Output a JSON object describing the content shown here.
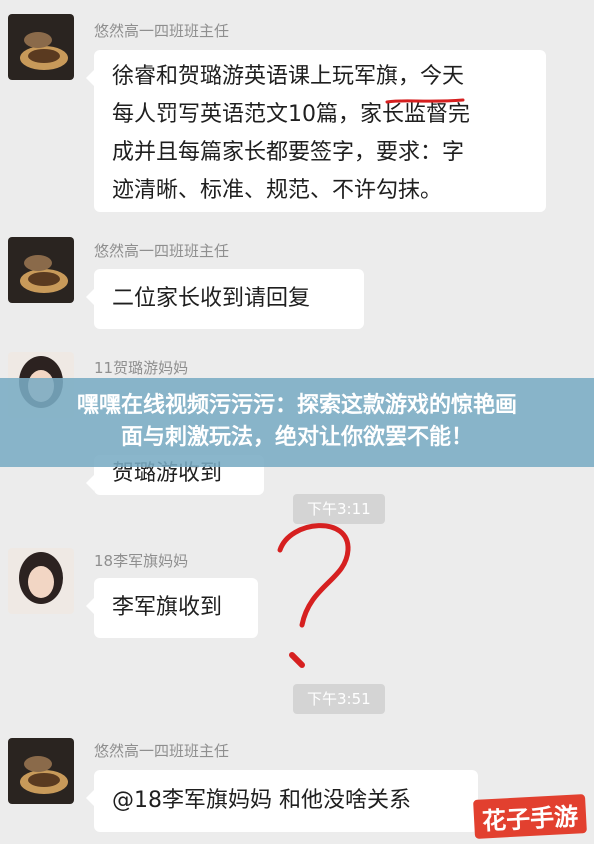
{
  "messages": [
    {
      "sender": "悠然高一四班班主任",
      "lines": [
        "徐睿和贺璐游英语课上玩军旗，今天",
        "每人罚写英语范文10篇，家长监督完",
        "成并且每篇家长都要签字，要求：字",
        "迹清晰、标准、规范、不许勾抹。"
      ]
    },
    {
      "sender": "悠然高一四班班主任",
      "lines": [
        "二位家长收到请回复"
      ]
    },
    {
      "sender": "11贺璐游妈妈",
      "lines": [
        "贺璐游收到"
      ]
    },
    {
      "sender": "18李军旗妈妈",
      "lines": [
        "李军旗收到"
      ]
    },
    {
      "sender": "悠然高一四班班主任",
      "lines": [
        "@18李军旗妈妈 和他没啥关系"
      ]
    }
  ],
  "timestamps": [
    "下午3:11",
    "下午3:51"
  ],
  "banner": {
    "line1": "嘿嘿在线视频污污污：探索这款游戏的惊艳画",
    "line2": "面与刺激玩法，绝对让你欲罢不能！"
  },
  "watermark": {
    "brand": "花子手游"
  },
  "colors": {
    "chat_bg": "#ececec",
    "bubble_bg": "#ffffff",
    "banner_bg": "#7aacc4",
    "red_annotation": "#d62020"
  },
  "icons": {
    "teacher_avatar": "coffee-cup-avatar-icon",
    "parent_avatar": "woman-portrait-avatar-icon"
  }
}
